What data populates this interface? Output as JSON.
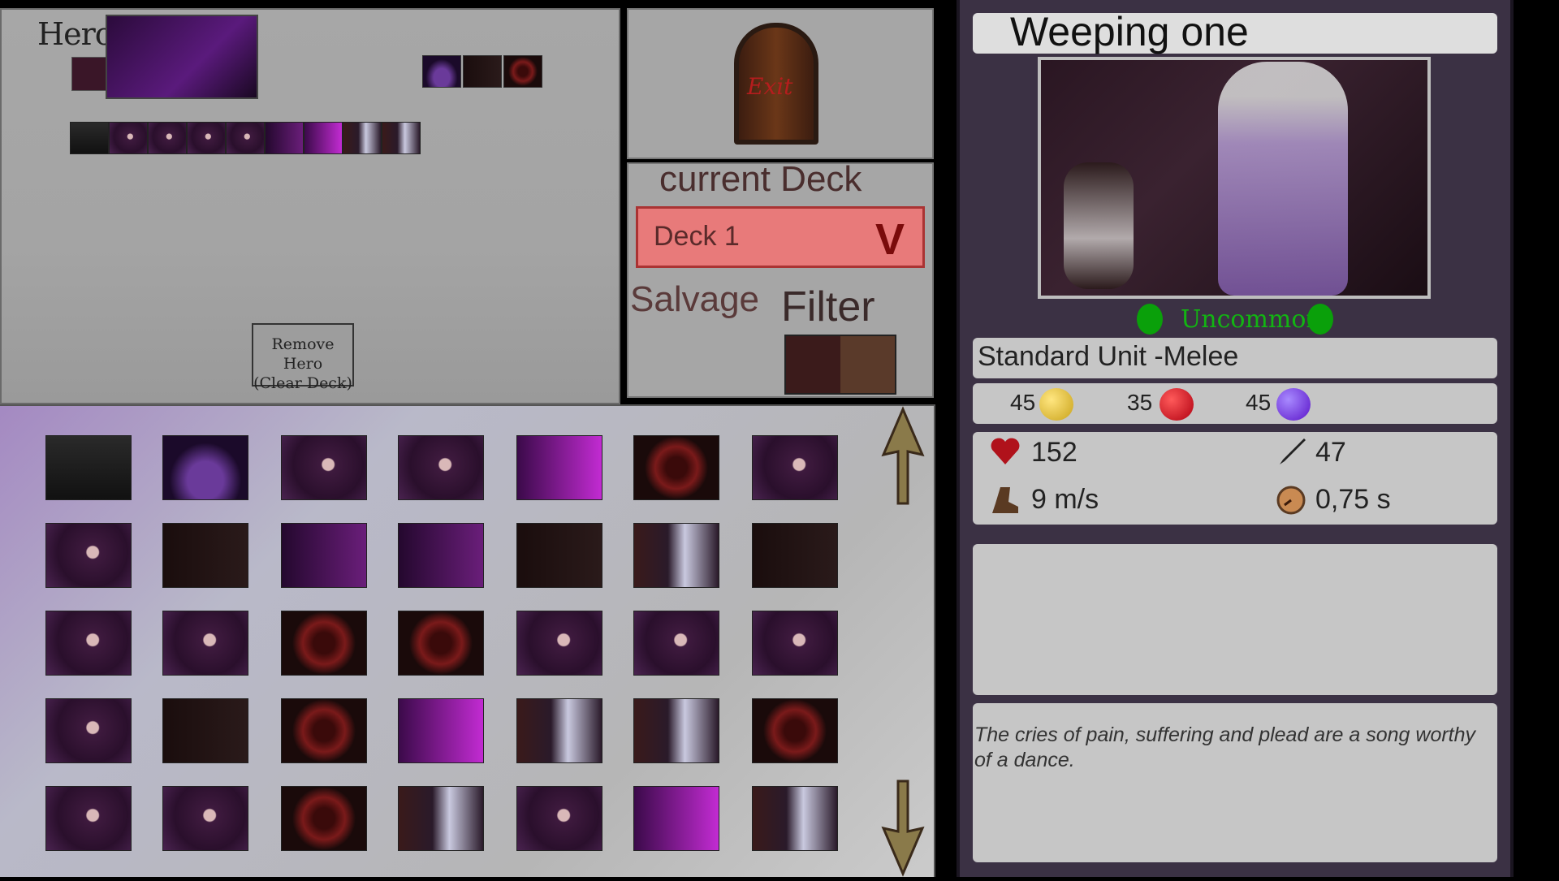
{
  "hero_panel": {
    "hero_label": "Hero:",
    "remove_hero_label": "Remove Hero\n(Clear Deck)"
  },
  "exit": {
    "label": "Exit"
  },
  "deck": {
    "current_deck_label": "current Deck",
    "selected": "Deck 1",
    "salvage_label": "Salvage",
    "filter_label": "Filter"
  },
  "collection": {
    "rows": [
      [
        "crypt",
        "altar",
        "scream",
        "scream",
        "girl",
        "pit",
        "scream"
      ],
      [
        "scream",
        "candles",
        "girl-dark",
        "girl-dark",
        "candles",
        "weeping",
        "candles"
      ],
      [
        "scream",
        "scream",
        "pit",
        "pit",
        "scream",
        "scream",
        "scream"
      ],
      [
        "scream",
        "candles",
        "pit",
        "girl",
        "weeping",
        "weeping",
        "pit"
      ],
      [
        "scream",
        "scream",
        "pit",
        "weeping",
        "scream",
        "girl",
        "weeping"
      ]
    ]
  },
  "unit": {
    "name": "Weeping one",
    "rarity": "Uncommon",
    "type": "Standard Unit -Melee",
    "cost": {
      "gold": "45",
      "red": "35",
      "purple": "45"
    },
    "stats": {
      "health": "152",
      "attack": "47",
      "speed": "9 m/s",
      "attack_speed": "0,75 s"
    },
    "description": "The cries of pain, suffering and plead are a song worthy of a dance."
  },
  "colors": {
    "rarity_green": "#12b512",
    "deck_red": "#e87a7a",
    "panel_dark": "#3b3144"
  }
}
